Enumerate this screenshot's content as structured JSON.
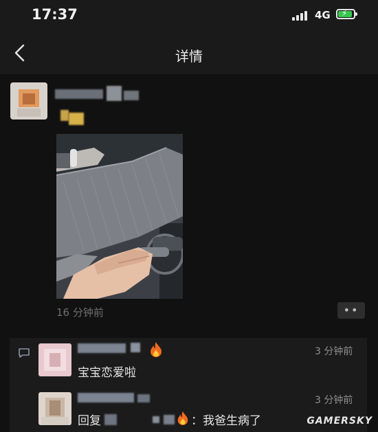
{
  "status_bar": {
    "time": "17:37",
    "network": "4G"
  },
  "nav": {
    "title": "详情"
  },
  "post": {
    "time_ago": "16 分钟前",
    "more_label": "••"
  },
  "comments": [
    {
      "time_ago": "3 分钟前",
      "text": "宝宝恋爱啦"
    },
    {
      "time_ago": "3 分钟前",
      "text_prefix": "回复",
      "text_suffix": "：我爸生病了"
    }
  ],
  "watermark": "GAMERSKY",
  "icons": {
    "back": "chevron-left-icon",
    "more": "more-icon",
    "comment": "comment-icon",
    "battery": "battery-charging-icon",
    "signal": "signal-icon"
  },
  "colors": {
    "background": "#111111",
    "accent_battery": "#37c84f",
    "comment_name": "#8a96a8"
  }
}
